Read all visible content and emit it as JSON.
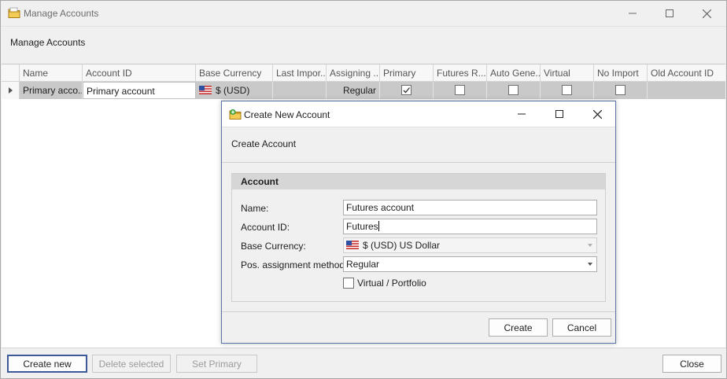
{
  "window": {
    "title": "Manage Accounts",
    "header": "Manage Accounts"
  },
  "grid": {
    "columns": [
      "Name",
      "Account ID",
      "Base Currency",
      "Last Impor...",
      "Assigning ...",
      "Primary",
      "Futures R...",
      "Auto Gene...",
      "Virtual",
      "No Import",
      "Old Account ID"
    ],
    "rows": [
      {
        "name": "Primary acco...",
        "account_id": "Primary account",
        "base_currency": "$ (USD)",
        "last_import": "",
        "assigning": "Regular",
        "primary": true,
        "futures_r": false,
        "auto_gene": false,
        "virtual": false,
        "no_import": false,
        "old_account_id": ""
      }
    ]
  },
  "footer": {
    "create_new": "Create new",
    "delete_selected": "Delete selected",
    "set_primary": "Set Primary",
    "close": "Close"
  },
  "dialog": {
    "title": "Create New Account",
    "header": "Create Account",
    "group_title": "Account",
    "name_label": "Name:",
    "name_value": "Futures account",
    "account_id_label": "Account ID:",
    "account_id_value": "Futures",
    "base_currency_label": "Base Currency:",
    "base_currency_value": "$ (USD) US Dollar",
    "pos_assignment_label": "Pos. assignment method",
    "pos_assignment_value": "Regular",
    "virtual_label": "Virtual / Portfolio",
    "virtual_checked": false,
    "create_button": "Create",
    "cancel_button": "Cancel"
  },
  "icons": {
    "app": "folder-icon",
    "dialog": "folder-add-icon",
    "currency_flag": "us-flag-icon"
  },
  "colors": {
    "selected_row": "#c9c9c9",
    "dialog_border": "#5a74a8",
    "primary_button_border": "#3c5a99"
  }
}
